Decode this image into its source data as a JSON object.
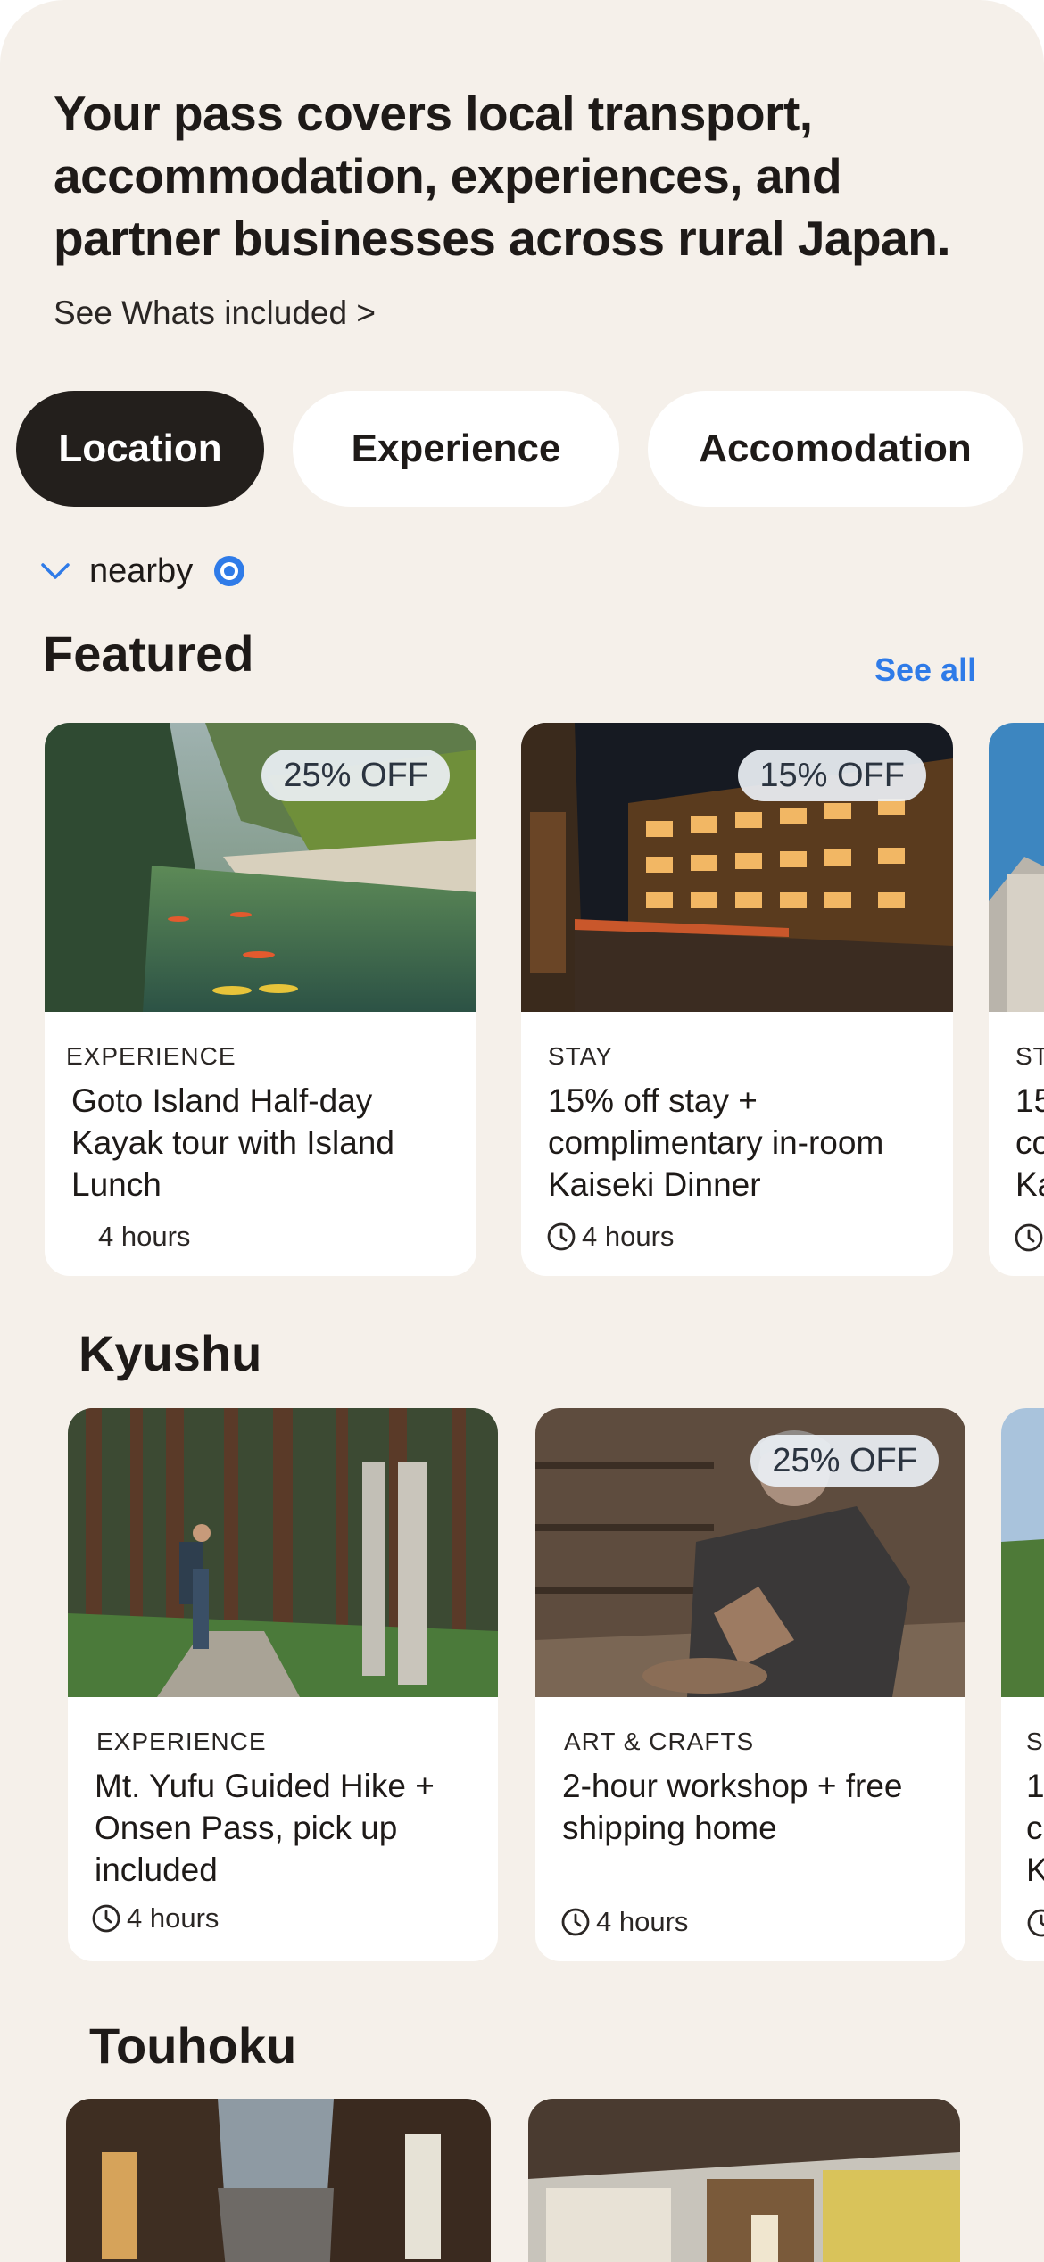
{
  "header": {
    "headline": "Your pass covers local transport, accommodation, experiences, and partner businesses across rural Japan.",
    "see_included": "See Whats included >"
  },
  "filters": {
    "chips": [
      "Location",
      "Experience",
      "Accomodation"
    ],
    "active": "Location",
    "nearby_label": "nearby"
  },
  "featured": {
    "title": "Featured",
    "see_all": "See all",
    "cards": [
      {
        "badge": "25% OFF",
        "category": "EXPERIENCE",
        "title": "Goto Island Half-day Kayak tour with Island Lunch",
        "duration": "4 hours",
        "image": "river-kayak-photo"
      },
      {
        "badge": "15% OFF",
        "category": "STAY",
        "title": "15% off stay + complimentary in-room Kaiseki Dinner",
        "duration": "4 hours",
        "image": "onsen-town-night-photo"
      },
      {
        "category": "ST",
        "title": "15\nco\nKa",
        "image": "castle-photo"
      }
    ]
  },
  "kyushu": {
    "title": "Kyushu",
    "cards": [
      {
        "category": "EXPERIENCE",
        "title": "Mt. Yufu Guided Hike + Onsen Pass, pick up included",
        "duration": "4 hours",
        "image": "forest-hike-photo"
      },
      {
        "badge": "25% OFF",
        "category": "ART & CRAFTS",
        "title": "2-hour workshop + free shipping home",
        "duration": "4 hours",
        "image": "pottery-workshop-photo"
      },
      {
        "category": "S",
        "title": "1\nc\nK",
        "image": "village-photo"
      }
    ]
  },
  "touhoku": {
    "title": "Touhoku"
  },
  "icons": {
    "chevron": "chevron-down-icon",
    "location": "location-dot-icon",
    "clock": "clock-icon"
  },
  "colors": {
    "background": "#f5f0ea",
    "active_chip": "#231f1c",
    "link": "#2f7be8"
  }
}
